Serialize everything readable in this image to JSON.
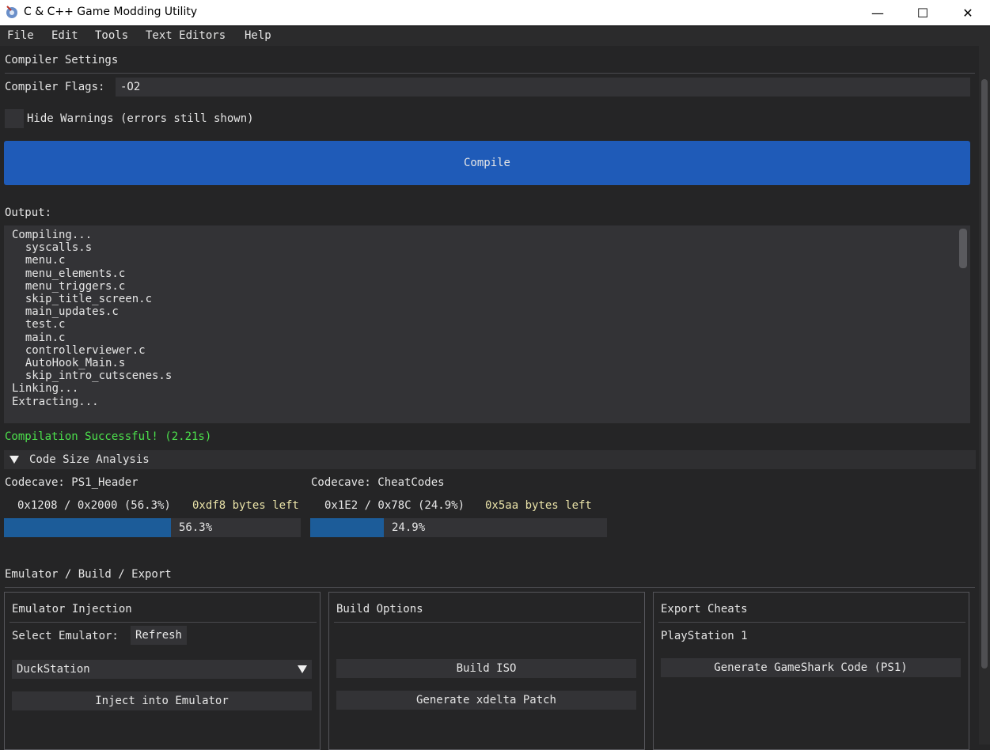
{
  "window": {
    "title": "C & C++ Game Modding Utility",
    "controls": {
      "minimize": "—",
      "maximize": "☐",
      "close": "✕"
    }
  },
  "menu": [
    "File",
    "Edit",
    "Tools",
    "Text Editors",
    "Help"
  ],
  "compiler_settings": {
    "header": "Compiler Settings",
    "flags_label": "Compiler Flags:",
    "flags_value": "-O2",
    "hide_warnings_label": "Hide Warnings (errors still shown)",
    "hide_warnings_checked": false,
    "compile_button": "Compile",
    "compile_button_color": "#1f5bb8"
  },
  "output": {
    "label": "Output:",
    "lines": [
      "Compiling...",
      "  syscalls.s",
      "  menu.c",
      "  menu_elements.c",
      "  menu_triggers.c",
      "  skip_title_screen.c",
      "  main_updates.c",
      "  test.c",
      "  main.c",
      "  controllerviewer.c",
      "  AutoHook_Main.s",
      "  skip_intro_cutscenes.s",
      "Linking...",
      "Extracting..."
    ],
    "status": "Compilation Successful! (2.21s)",
    "status_color": "#4ce04c"
  },
  "code_size": {
    "header": "Code Size Analysis",
    "expanded": true,
    "codecaves": [
      {
        "title": "Codecave: PS1_Header",
        "usage": "0x1208 / 0x2000 (56.3%)",
        "left": "0xdf8 bytes left",
        "percent_label": "56.3%",
        "fraction": 0.563
      },
      {
        "title": "Codecave: CheatCodes",
        "usage": "0x1E2 / 0x78C (24.9%)",
        "left": "0x5aa bytes left",
        "percent_label": "24.9%",
        "fraction": 0.249
      }
    ]
  },
  "emu_build_export": {
    "header": "Emulator / Build / Export",
    "emulator": {
      "title": "Emulator Injection",
      "select_label": "Select Emulator:",
      "refresh_button": "Refresh",
      "selected": "DuckStation",
      "inject_button": "Inject into Emulator"
    },
    "build": {
      "title": "Build Options",
      "build_iso_button": "Build ISO",
      "xdelta_button": "Generate xdelta Patch"
    },
    "export": {
      "title": "Export Cheats",
      "platform": "PlayStation 1",
      "gameshark_button": "Generate GameShark Code (PS1)"
    }
  }
}
